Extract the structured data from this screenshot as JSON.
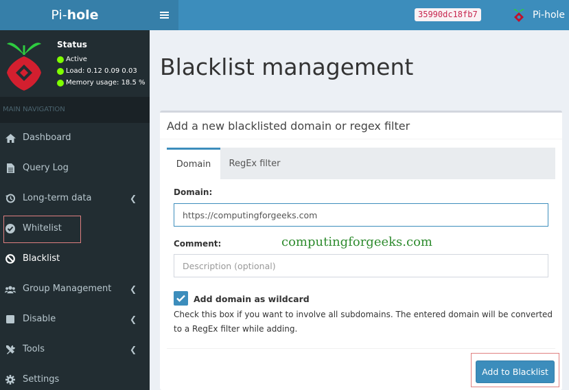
{
  "header": {
    "logo_pre": "Pi-",
    "logo_bold": "hole",
    "hash": "35990dc18fb7",
    "user_label": "Pi-hole"
  },
  "sidebar": {
    "status_title": "Status",
    "status_active": "Active",
    "status_load": "Load:  0.12  0.09  0.03",
    "status_memory": "Memory usage:  18.5 %",
    "section_header": "MAIN NAVIGATION",
    "items": [
      {
        "label": "Dashboard",
        "icon": "home-icon",
        "has_submenu": false
      },
      {
        "label": "Query Log",
        "icon": "file-icon",
        "has_submenu": false
      },
      {
        "label": "Long-term data",
        "icon": "history-icon",
        "has_submenu": true
      },
      {
        "label": "Whitelist",
        "icon": "check-circle-icon",
        "has_submenu": false
      },
      {
        "label": "Blacklist",
        "icon": "ban-icon",
        "has_submenu": false,
        "active": true
      },
      {
        "label": "Group Management",
        "icon": "users-icon",
        "has_submenu": true
      },
      {
        "label": "Disable",
        "icon": "stop-icon",
        "has_submenu": true
      },
      {
        "label": "Tools",
        "icon": "tools-icon",
        "has_submenu": true
      },
      {
        "label": "Settings",
        "icon": "gear-icon",
        "has_submenu": false
      }
    ]
  },
  "main": {
    "page_title": "Blacklist management",
    "box_title": "Add a new blacklisted domain or regex filter",
    "tabs": [
      {
        "label": "Domain",
        "active": true
      },
      {
        "label": "RegEx filter",
        "active": false
      }
    ],
    "domain_label": "Domain:",
    "domain_value": "https://computingforgeeks.com",
    "comment_label": "Comment:",
    "comment_placeholder": "Description (optional)",
    "watermark": "computingforgeeks.com",
    "wildcard_label": "Add domain as wildcard",
    "wildcard_checked": true,
    "help_text": "Check this box if you want to involve all subdomains. The entered domain will be converted to a RegEx filter while adding.",
    "add_button": "Add to Blacklist"
  },
  "colors": {
    "header_dark": "#367fa9",
    "header": "#3c8dbc",
    "sidebar": "#222d32",
    "status_dot": "#7fff00",
    "highlight": "#e08080"
  }
}
